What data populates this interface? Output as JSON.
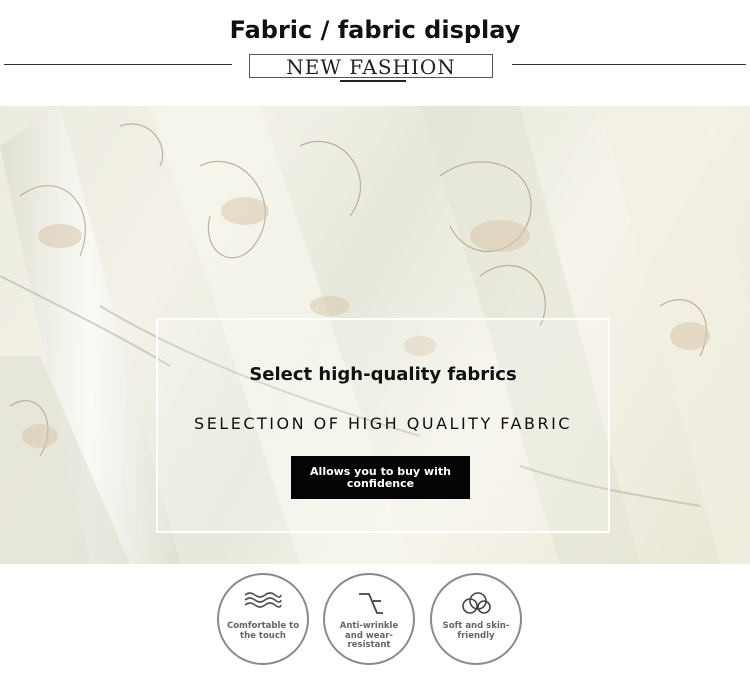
{
  "header": {
    "title": "Fabric / fabric display",
    "badge": "NEW FASHION"
  },
  "hero": {
    "heading": "Select high-quality fabrics",
    "subheading": "SELECTION OF HIGH QUALITY FABRIC",
    "cta_label": "Allows you to buy with confidence"
  },
  "features": [
    {
      "label": "Comfortable to the touch",
      "icon": "waves-icon"
    },
    {
      "label": "Anti-wrinkle and wear-resistant",
      "icon": "crease-icon"
    },
    {
      "label": "Soft and skin-friendly",
      "icon": "cloud-icon"
    }
  ],
  "colors": {
    "text": "#111111",
    "cta_background": "#050505",
    "circle_border": "#8a8a8a"
  }
}
